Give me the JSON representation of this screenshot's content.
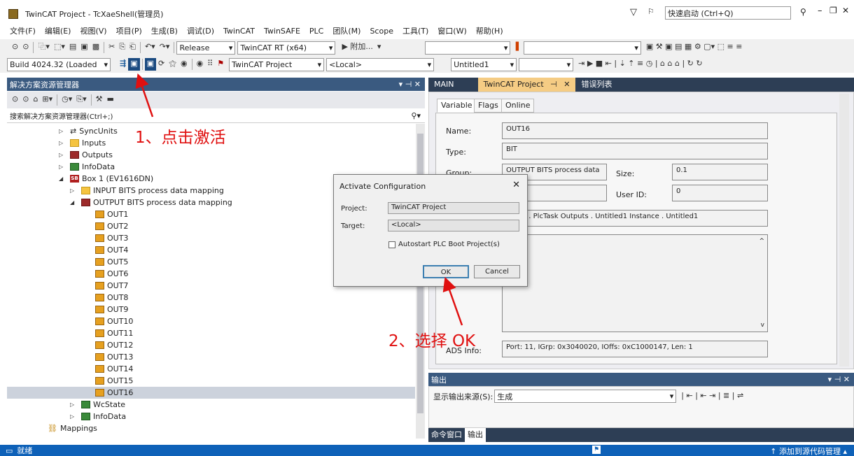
{
  "window": {
    "title": "TwinCAT Project - TcXaeShell(管理员)",
    "quick_launch": "快速启动 (Ctrl+Q)"
  },
  "menu": [
    "文件(F)",
    "编辑(E)",
    "视图(V)",
    "项目(P)",
    "生成(B)",
    "调试(D)",
    "TwinCAT",
    "TwinSAFE",
    "PLC",
    "团队(M)",
    "Scope",
    "工具(T)",
    "窗口(W)",
    "帮助(H)"
  ],
  "toolbar1": {
    "config": "Release",
    "platform": "TwinCAT RT (x64)",
    "attach": "▶ 附加..."
  },
  "toolbar2": {
    "build": "Build 4024.32 (Loaded",
    "project": "TwinCAT Project",
    "target": "<Local>",
    "plc": "Untitled1"
  },
  "solution": {
    "title": "解决方案资源管理器",
    "search": "搜索解决方案资源管理器(Ctrl+;)"
  },
  "tree": {
    "syncunits": "SyncUnits",
    "inputs": "Inputs",
    "outputs": "Outputs",
    "infodata": "InfoData",
    "box": "Box 1 (EV1616DN)",
    "box_badge": "SB",
    "input_bits": "INPUT BITS process data mapping",
    "output_bits": "OUTPUT BITS process data mapping",
    "outs": [
      "OUT1",
      "OUT2",
      "OUT3",
      "OUT4",
      "OUT5",
      "OUT6",
      "OUT7",
      "OUT8",
      "OUT9",
      "OUT10",
      "OUT11",
      "OUT12",
      "OUT13",
      "OUT14",
      "OUT15",
      "OUT16"
    ],
    "wcstate": "WcState",
    "infodata2": "InfoData",
    "mappings": "Mappings"
  },
  "doc_tabs": {
    "main": "MAIN",
    "active": "TwinCAT Project",
    "errors": "错误列表"
  },
  "props": {
    "tabs": [
      "Variable",
      "Flags",
      "Online"
    ],
    "name_label": "Name:",
    "name": "OUT16",
    "type_label": "Type:",
    "type": "BIT",
    "group_label": "Group:",
    "group": "OUTPUT BITS process data",
    "size_label": "Size:",
    "size": "0.1",
    "userid_label": "User ID:",
    "userid": "0",
    "link": "out16 . PlcTask Outputs . Untitled1 Instance . Untitled1",
    "ads_label": "ADS Info:",
    "ads": "Port: 11, IGrp: 0x3040020, IOffs: 0xC1000147, Len: 1"
  },
  "output": {
    "title": "输出",
    "source_label": "显示输出来源(S):",
    "source": "生成",
    "tab_cmd": "命令窗口",
    "tab_out": "输出"
  },
  "status": {
    "ready": "就绪",
    "source_control": "添加到源代码管理"
  },
  "dialog": {
    "title": "Activate Configuration",
    "project_label": "Project:",
    "project": "TwinCAT Project",
    "target_label": "Target:",
    "target": "<Local>",
    "autostart": "Autostart PLC Boot Project(s)",
    "ok": "OK",
    "cancel": "Cancel"
  },
  "annotations": {
    "step1": "1、点击激活",
    "step2": "2、选择 OK"
  }
}
